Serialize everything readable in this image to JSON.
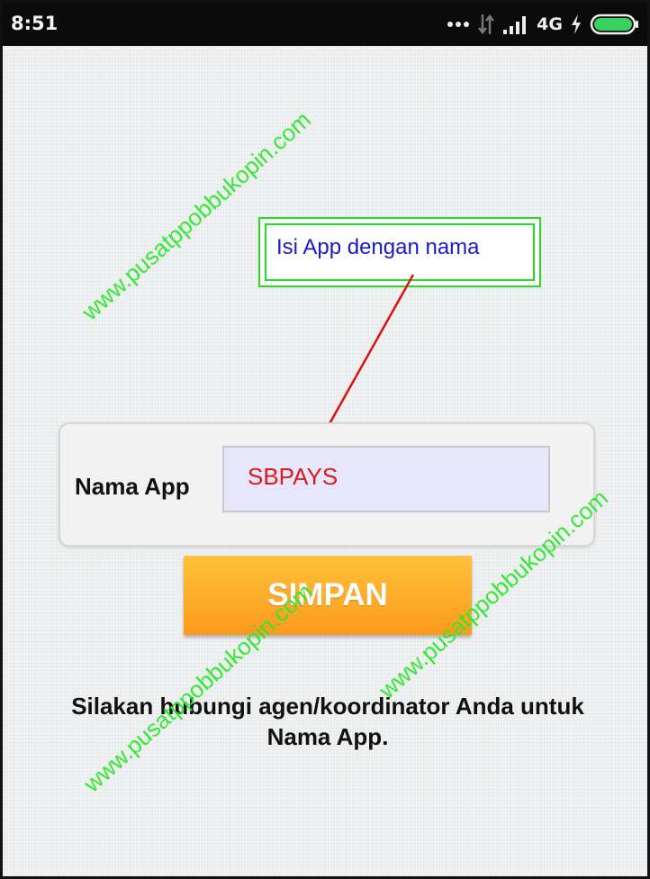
{
  "status_bar": {
    "time": "8:51",
    "network": "4G",
    "icons": [
      "dots-icon",
      "data-transfer-icon",
      "signal-icon",
      "charging-bolt-icon",
      "battery-icon"
    ],
    "battery_color": "#39d15e"
  },
  "callout": {
    "text": "Isi App dengan nama"
  },
  "form": {
    "label": "Nama App",
    "value": "SBPAYS"
  },
  "save_button": {
    "label": "SIMPAN"
  },
  "info_text": {
    "line1": "Silakan hubungi agen/koordinator Anda untuk",
    "line2": "Nama App."
  },
  "watermark": {
    "text": "www.pusatppobbukopin.com",
    "color": "#2ee82e"
  },
  "colors": {
    "button": "#fba42a",
    "input_bg": "#e8e6fb",
    "input_text": "#d81b1b",
    "callout_text": "#1a1acc",
    "arrow": "#dd1111"
  }
}
